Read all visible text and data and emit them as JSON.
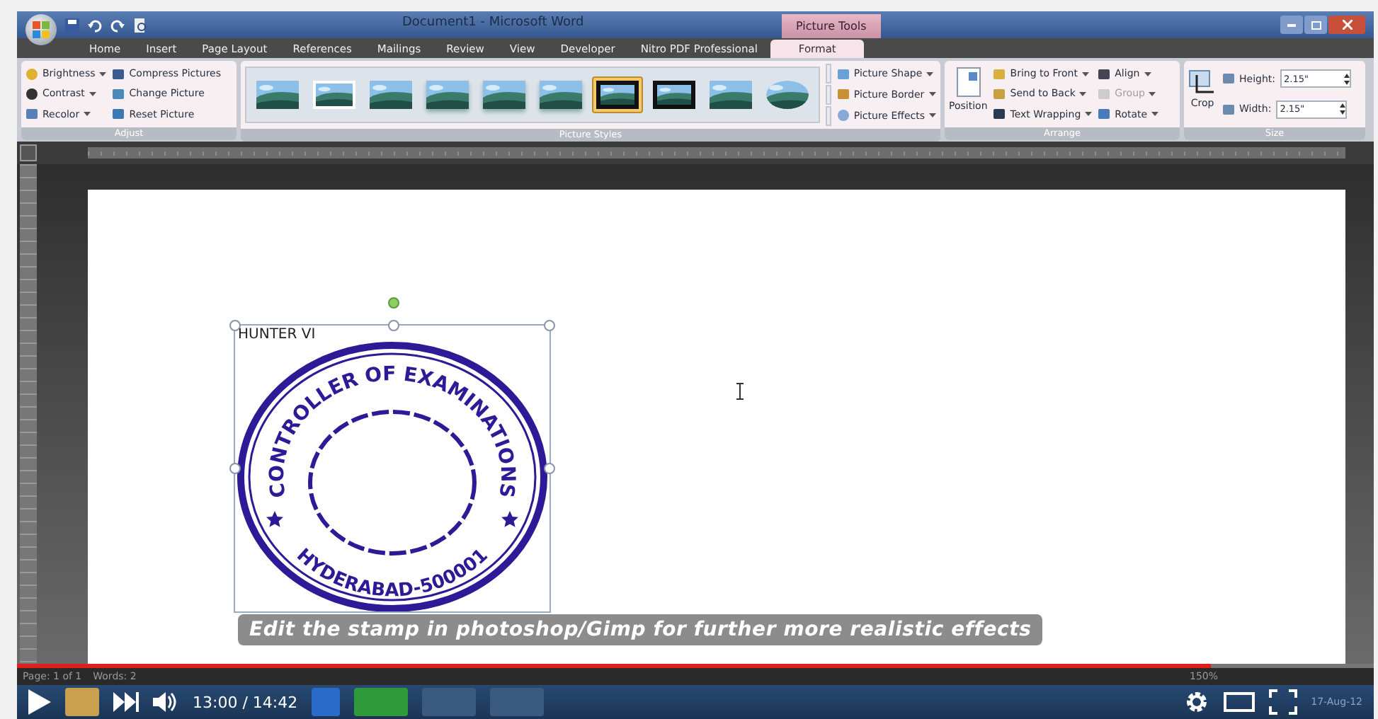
{
  "window": {
    "title": "Document1 - Microsoft Word",
    "context_title": "Picture Tools"
  },
  "tabs": [
    {
      "label": "Home",
      "selected": false
    },
    {
      "label": "Insert",
      "selected": false
    },
    {
      "label": "Page Layout",
      "selected": false
    },
    {
      "label": "References",
      "selected": false
    },
    {
      "label": "Mailings",
      "selected": false
    },
    {
      "label": "Review",
      "selected": false
    },
    {
      "label": "View",
      "selected": false
    },
    {
      "label": "Developer",
      "selected": false
    },
    {
      "label": "Nitro PDF Professional",
      "selected": false
    },
    {
      "label": "Format",
      "selected": true
    }
  ],
  "adjust": {
    "label": "Adjust",
    "items": [
      {
        "label": "Brightness",
        "kind": "menu"
      },
      {
        "label": "Contrast",
        "kind": "menu"
      },
      {
        "label": "Recolor",
        "kind": "menu"
      },
      {
        "label": "Compress Pictures",
        "kind": "command"
      },
      {
        "label": "Change Picture",
        "kind": "command"
      },
      {
        "label": "Reset Picture",
        "kind": "command"
      }
    ]
  },
  "picture_styles": {
    "label": "Picture Styles",
    "styles": [
      {
        "kind": "thin",
        "selected": false
      },
      {
        "kind": "white",
        "selected": false
      },
      {
        "kind": "thin",
        "selected": false
      },
      {
        "kind": "soft",
        "selected": false
      },
      {
        "kind": "soft",
        "selected": false
      },
      {
        "kind": "soft",
        "selected": false
      },
      {
        "kind": "black",
        "selected": true
      },
      {
        "kind": "black",
        "selected": false
      },
      {
        "kind": "plain",
        "selected": false
      },
      {
        "kind": "oval",
        "selected": false
      }
    ],
    "items": [
      {
        "label": "Picture Shape"
      },
      {
        "label": "Picture Border"
      },
      {
        "label": "Picture Effects"
      }
    ]
  },
  "arrange": {
    "label": "Arrange",
    "position": "Position",
    "items": [
      {
        "label": "Bring to Front",
        "disabled": false
      },
      {
        "label": "Send to Back",
        "disabled": false
      },
      {
        "label": "Text Wrapping",
        "disabled": false
      },
      {
        "label": "Align",
        "disabled": false
      },
      {
        "label": "Group",
        "disabled": true
      },
      {
        "label": "Rotate",
        "disabled": false
      }
    ]
  },
  "size": {
    "label": "Size",
    "crop": "Crop",
    "fields": [
      {
        "label": "Height:",
        "value": "2.15\""
      },
      {
        "label": "Width:",
        "value": "2.15\""
      }
    ]
  },
  "document": {
    "heading": "HUNTER VI",
    "stamp_top": "CONTROLLER OF EXAMINATIONS",
    "stamp_bottom": "HYDERABAD-500001"
  },
  "status_bar": {
    "page": "Page: 1 of 1",
    "words": "Words: 2",
    "zoom": "150%"
  },
  "player": {
    "subtitle": "Edit the stamp in photoshop/Gimp for further more realistic effects",
    "time": "13:00 / 14:42",
    "progress": {
      "level": 0.88
    }
  },
  "taskbar": {
    "date": "17-Aug-12"
  }
}
